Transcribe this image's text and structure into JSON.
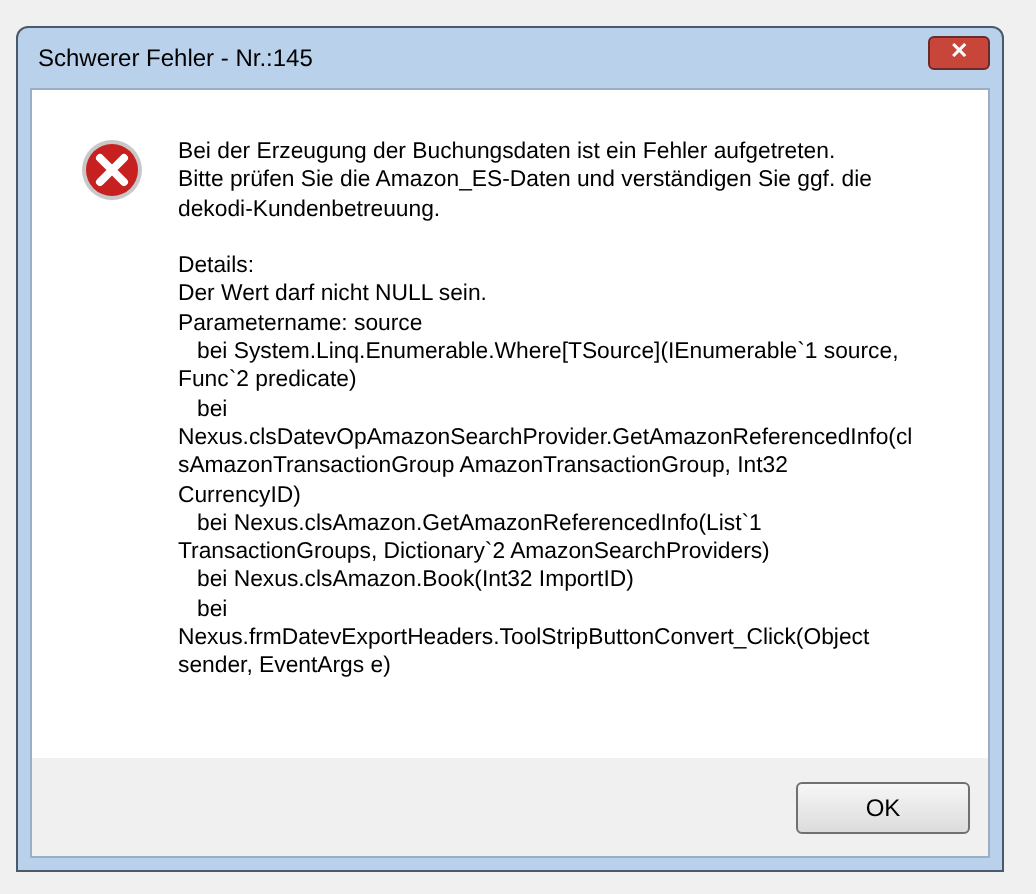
{
  "window": {
    "title": "Schwerer Fehler - Nr.:145",
    "close": "✕"
  },
  "message": [
    "Bei der Erzeugung der Buchungsdaten ist ein Fehler aufgetreten.",
    "Bitte prüfen Sie die Amazon_ES-Daten und verständigen Sie ggf. die",
    "dekodi-Kundenbetreuung."
  ],
  "details": [
    "Details:",
    "Der Wert darf nicht NULL sein.",
    "Parametername: source",
    "   bei System.Linq.Enumerable.Where[TSource](IEnumerable`1 source,",
    "Func`2 predicate)",
    "   bei",
    "Nexus.clsDatevOpAmazonSearchProvider.GetAmazonReferencedInfo(cl",
    "sAmazonTransactionGroup AmazonTransactionGroup, Int32",
    "CurrencyID)",
    "   bei Nexus.clsAmazon.GetAmazonReferencedInfo(List`1",
    "TransactionGroups, Dictionary`2 AmazonSearchProviders)",
    "   bei Nexus.clsAmazon.Book(Int32 ImportID)",
    "   bei",
    "Nexus.frmDatevExportHeaders.ToolStripButtonConvert_Click(Object",
    "sender, EventArgs e)"
  ],
  "buttons": [
    "OK"
  ]
}
